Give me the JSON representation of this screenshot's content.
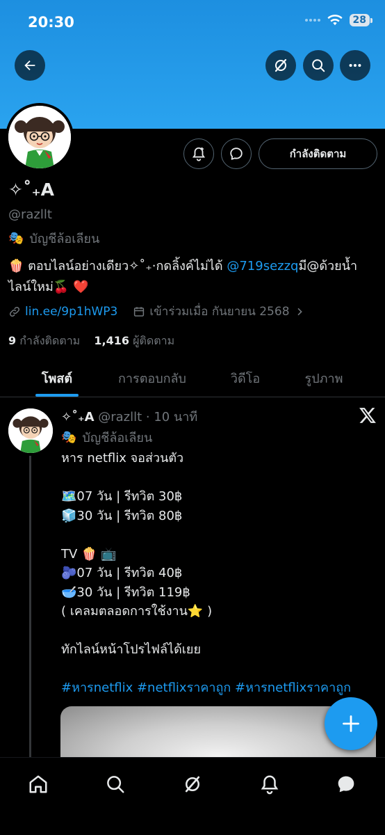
{
  "status_bar": {
    "time": "20:30",
    "battery": "28"
  },
  "profile": {
    "display_name": "✧˚₊A",
    "handle": "@razllt",
    "parody_label": "บัญชีล้อเลียน",
    "bio_emoji": "🍿",
    "bio_text": " ตอบไลน์อย่างเดียว✧˚₊·กดลิ้งค์ไม่ได้ ",
    "bio_mention": "@719sezzq",
    "bio_text_2": "มี@ด้วยน้ำ ไลน์ใหม่🍒 ❤️",
    "website": "lin.ee/9p1hWP3",
    "joined": "เข้าร่วมเมื่อ กันยายน 2568",
    "following_count": "9",
    "following_label": "กำลังติดตาม",
    "followers_count": "1,416",
    "followers_label": "ผู้ติดตาม"
  },
  "actions": {
    "following_button": "กำลังติดตาม"
  },
  "tabs": [
    {
      "label": "โพสต์"
    },
    {
      "label": "การตอบกลับ"
    },
    {
      "label": "วิดีโอ"
    },
    {
      "label": "รูปภาพ"
    }
  ],
  "post": {
    "display_name": "✧˚₊A",
    "meta": " @razllt · 10 นาที",
    "parody_label": "บัญชีล้อเลียน",
    "lines": [
      "หาร netflix จอส่วนตัว",
      "",
      "🗺️07  วัน |  รีทวิต 30฿",
      "🧊30  วัน | รีทวิต 80฿",
      "",
      "TV 🍿 📺",
      "🫐07  วัน | รีทวิต 40฿",
      "🥣30  วัน | รีทวิต 119฿",
      "( เคลมตลอดการใช้งาน⭐ )",
      "",
      "ทักไลน์หน้าโปรไฟล์ได้เยย",
      "",
      "#หารnetflix #netflixราคาถูก #หารnetflixราคาถูก"
    ]
  },
  "colors": {
    "accent": "#1d9bf0",
    "banner": "#2aa3ef",
    "muted": "#71767b",
    "text": "#e7e9ea"
  },
  "icons": [
    "back-arrow-icon",
    "grok-icon",
    "search-icon",
    "more-icon",
    "notification-add-icon",
    "message-icon",
    "link-icon",
    "calendar-icon",
    "chevron-right-icon",
    "x-logo-icon",
    "compose-plus-icon",
    "home-icon",
    "grok-nav-icon",
    "bell-icon",
    "messages-nav-icon"
  ]
}
